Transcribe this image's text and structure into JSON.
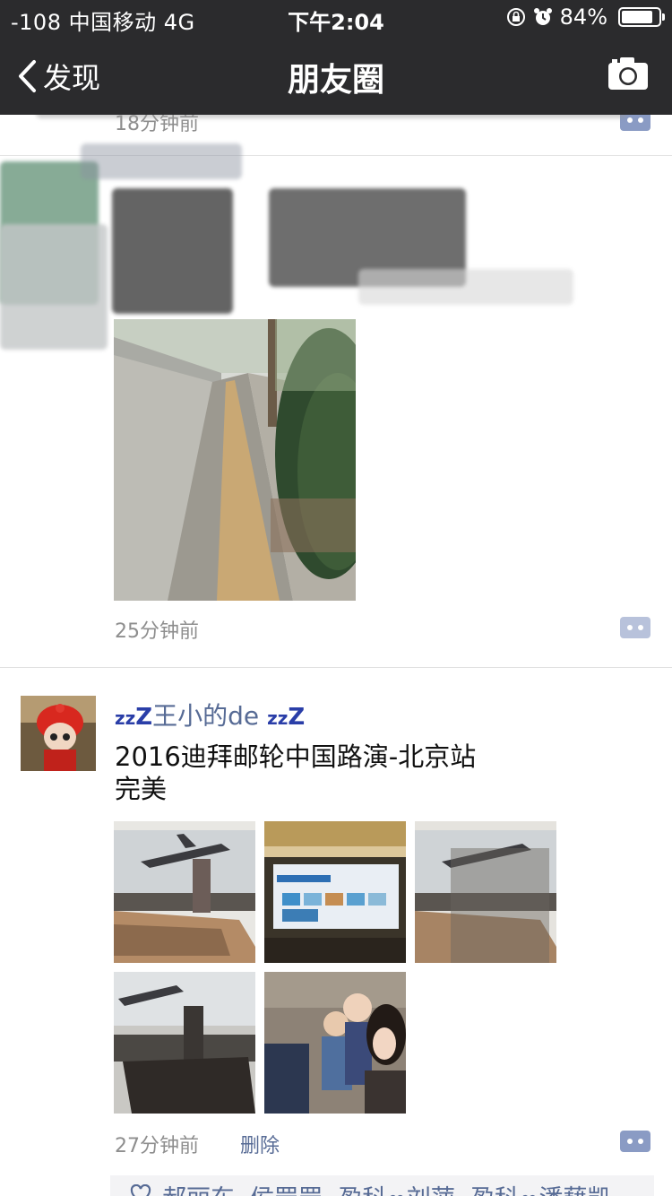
{
  "status_bar": {
    "carrier": "-108 中国移动   4G",
    "time": "下午2:04",
    "battery": "84%",
    "battery_level": 0.84,
    "icons": [
      "rotation-lock-icon",
      "alarm-icon",
      "battery-icon"
    ]
  },
  "nav": {
    "back_label": "发现",
    "title": "朋友圈",
    "right_icon": "camera-icon"
  },
  "feed": {
    "prev_post_time": "18分钟前",
    "post1": {
      "time": "25分钟前"
    },
    "post2": {
      "username": "王小的de",
      "zz_prefix": "z",
      "zz_suffix": "Z",
      "text_line1": "2016迪拜邮轮中国路演-北京站",
      "text_line2": "完美",
      "photo_count": 5,
      "time": "27分钟前",
      "delete_label": "删除",
      "likes": "郝丽东, 侯罡罡, 盈科∞刘萍, 盈科∞潘藉凯"
    }
  },
  "colors": {
    "nav_bg": "#2b2b2d",
    "link_blue": "#576b95",
    "time_gray": "#8e8e8e",
    "comment_button": "#8a9bc4"
  }
}
